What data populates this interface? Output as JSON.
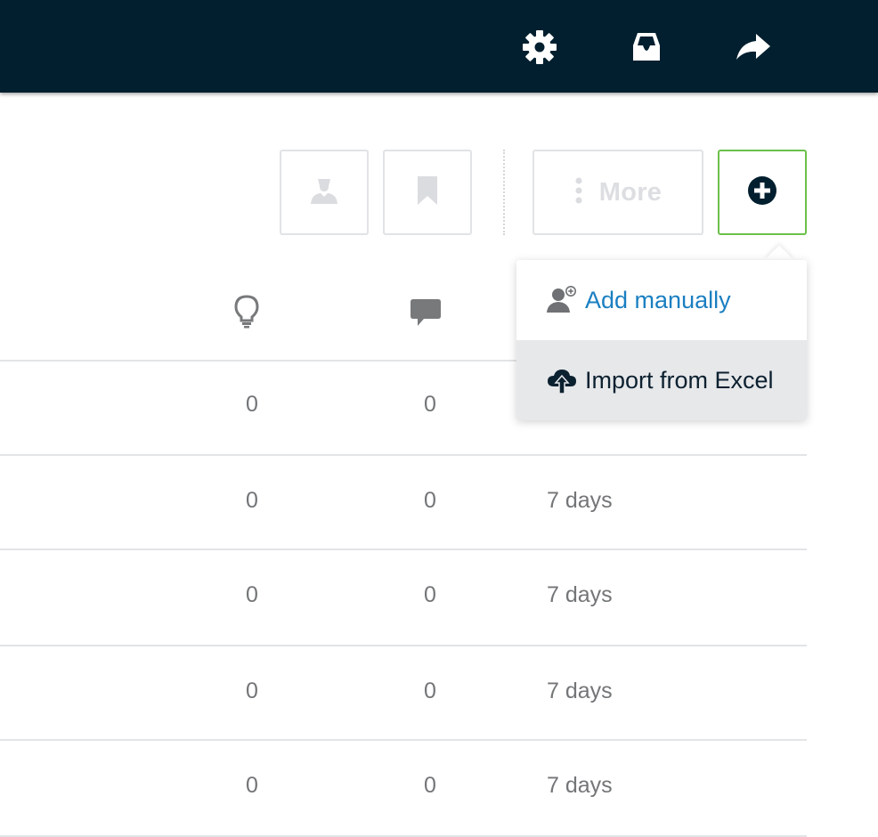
{
  "topbar": {
    "background": "#011f2f",
    "icons": [
      "gear-icon",
      "inbox-icon",
      "share-icon"
    ]
  },
  "toolbar": {
    "more_label": "More",
    "accent": "#6cc04a"
  },
  "columns": {
    "icons": [
      "lightbulb-icon",
      "comment-icon"
    ]
  },
  "rows": [
    {
      "ideas": "0",
      "comments": "0",
      "duration": ""
    },
    {
      "ideas": "0",
      "comments": "0",
      "duration": "7 days"
    },
    {
      "ideas": "0",
      "comments": "0",
      "duration": "7 days"
    },
    {
      "ideas": "0",
      "comments": "0",
      "duration": "7 days"
    },
    {
      "ideas": "0",
      "comments": "0",
      "duration": "7 days"
    }
  ],
  "dropdown": {
    "items": [
      {
        "label": "Add manually",
        "icon": "add-user-icon",
        "color": "#1a7fc1"
      },
      {
        "label": "Import from Excel",
        "icon": "cloud-upload-icon",
        "color": "#0c2130"
      }
    ]
  }
}
